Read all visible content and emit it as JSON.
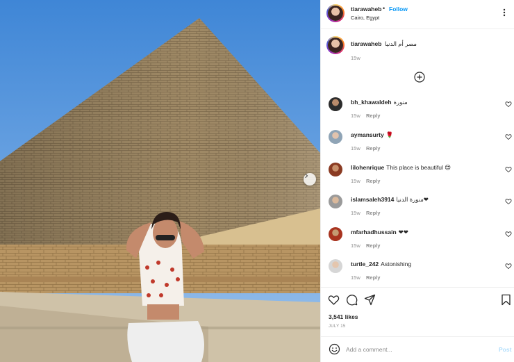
{
  "post": {
    "username": "tiarawaheb",
    "follow_label": "Follow",
    "separator": "•",
    "location": "Cairo, Egypt",
    "more_label": "•••"
  },
  "caption": {
    "username": "tiarawaheb",
    "text": "مصر أم الدنيا",
    "time": "15w"
  },
  "comments": [
    {
      "username": "bh_khawaldeh",
      "text": "منورة",
      "time": "15w",
      "reply": "Reply"
    },
    {
      "username": "aymansurty",
      "text": "🌹",
      "time": "15w",
      "reply": "Reply"
    },
    {
      "username": "lilohenrique",
      "text": "This place is beautiful 😍",
      "time": "15w",
      "reply": "Reply"
    },
    {
      "username": "islamsaleh3914",
      "text": "منورة الدنيا❤",
      "time": "15w",
      "reply": "Reply"
    },
    {
      "username": "mfarhadhussain",
      "text": "❤❤",
      "time": "15w",
      "reply": "Reply"
    },
    {
      "username": "turtle_242",
      "text": "Astonishing",
      "time": "15w",
      "reply": "Reply"
    }
  ],
  "likes": "3,541 likes",
  "date": "JULY 15",
  "add_comment": {
    "placeholder": "Add a comment...",
    "post_label": "Post"
  },
  "icons": {
    "more": "more-options-icon",
    "load_more": "plus-circle-icon",
    "heart": "heart-icon",
    "comment": "comment-icon",
    "share": "share-icon",
    "save": "bookmark-icon",
    "emoji": "emoji-icon",
    "next": "chevron-right-icon"
  },
  "colors": {
    "accent": "#0095f6",
    "muted": "#8e8e8e",
    "post_disabled": "#b2dffc",
    "text": "#262626"
  }
}
